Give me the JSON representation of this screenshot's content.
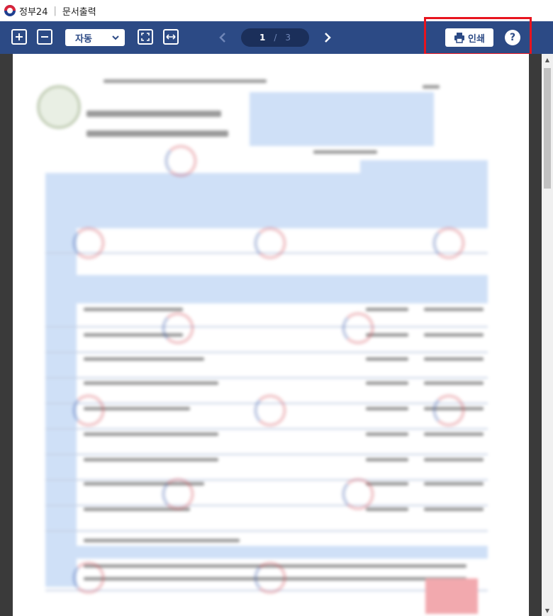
{
  "app": {
    "name": "정부24",
    "title": "문서출력"
  },
  "toolbar": {
    "zoom_in_icon": "plus-square-icon",
    "zoom_out_icon": "minus-square-icon",
    "zoom_mode": "자동",
    "fit_page_icon": "fit-page-icon",
    "fit_width_icon": "fit-width-icon",
    "current_page": "1",
    "page_separator": "/",
    "total_pages": "3",
    "print_label": "인쇄",
    "help_label": "?"
  },
  "document": {
    "content": "blurred-official-certificate",
    "table_row_count": 11
  },
  "colors": {
    "toolbar_bg": "#2c4a85",
    "pager_bg": "#1b2f5a",
    "highlight_border": "#e8141e"
  }
}
